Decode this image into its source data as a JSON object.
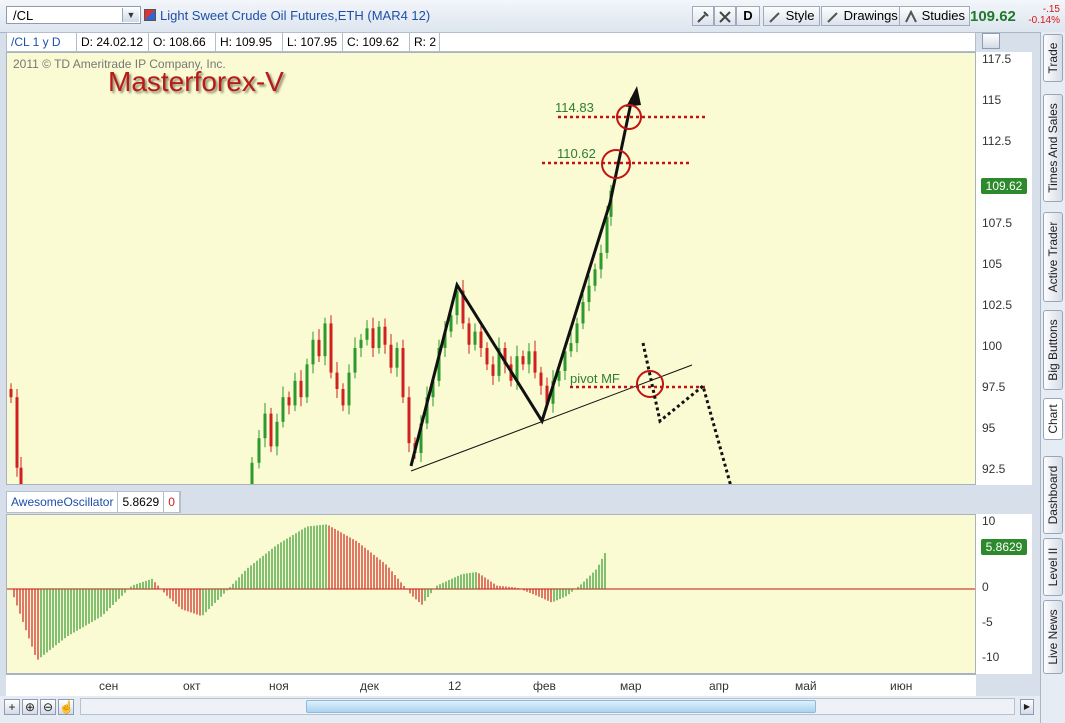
{
  "header": {
    "symbol": "/CL",
    "instrument_title": "Light Sweet Crude Oil Futures,ETH (MAR4 12)",
    "buttons": {
      "d_label": "D",
      "style_label": "Style",
      "drawings_label": "Drawings",
      "studies_label": "Studies"
    },
    "last_price": "109.62",
    "change": "-.15",
    "change_pct": "-0.14%"
  },
  "info_bar": {
    "symbol_period": "/CL 1 y D",
    "date": "D: 24.02.12",
    "open": "O: 108.66",
    "high": "H: 109.95",
    "low": "L: 107.95",
    "close": "C: 109.62",
    "range": "R: 2"
  },
  "chart": {
    "copyright": "2011 © TD Ameritrade IP Company, Inc.",
    "watermark": "Masterforex-V",
    "annotations": {
      "level1": "114.83",
      "level2": "110.62",
      "pivot": "pivot MF"
    },
    "price_tag": "109.62",
    "price_axis": [
      "117.5",
      "115",
      "112.5",
      "107.5",
      "105",
      "102.5",
      "100",
      "97.5",
      "95",
      "92.5"
    ]
  },
  "oscillator": {
    "name": "AwesomeOscillator",
    "value": "5.8629",
    "extra": "0",
    "axis": [
      "10",
      "0",
      "-5",
      "-10"
    ],
    "value_tag": "5.8629"
  },
  "date_axis": [
    "сен",
    "окт",
    "ноя",
    "дек",
    "12",
    "фев",
    "мар",
    "апр",
    "май",
    "июн"
  ],
  "sidebar": [
    "Trade",
    "Times And Sales",
    "Active Trader",
    "Big Buttons",
    "Chart",
    "Dashboard",
    "Level II",
    "Live News"
  ],
  "colors": {
    "up": "#2e9a2e",
    "down": "#d02020",
    "background": "#fafbd2",
    "price_tag": "#2c8a2c"
  },
  "chart_data": {
    "type": "candlestick",
    "y_range": [
      91,
      118.5
    ],
    "annotation_levels": [
      114.83,
      110.62,
      97.5
    ],
    "oscillator_range": [
      -11,
      12
    ]
  }
}
